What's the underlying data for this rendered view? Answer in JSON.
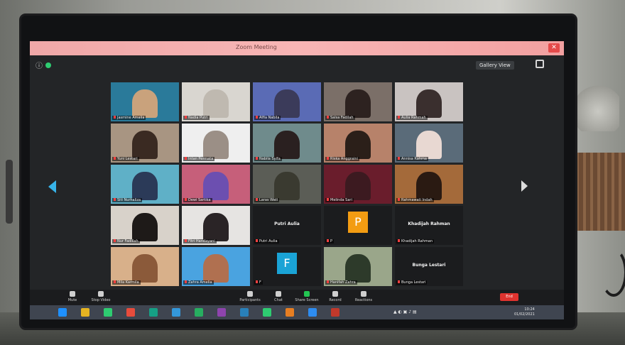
{
  "window": {
    "title": "Zoom Meeting",
    "view_label": "Gallery View",
    "end_label": "End"
  },
  "participants": [
    {
      "name": "Jasmine Amalia",
      "style": "photo",
      "bg": "#2a7a9a",
      "fg": "#c9a27c"
    },
    {
      "name": "Nadia Putri",
      "style": "photo",
      "bg": "#d9d6d0",
      "fg": "#bfb9b0"
    },
    {
      "name": "Alfia Nabila",
      "style": "photo",
      "bg": "#5a6bb5",
      "fg": "#3b3b5a"
    },
    {
      "name": "Salsa Fadilah",
      "style": "photo",
      "bg": "#7b6f68",
      "fg": "#2d2220"
    },
    {
      "name": "Aulia Rahmah",
      "style": "photo",
      "bg": "#c9c3c1",
      "fg": "#3a2f2e"
    },
    {
      "name": "Yuni Lestari",
      "style": "photo",
      "bg": "#a89582",
      "fg": "#3a2a22"
    },
    {
      "name": "Intan Permata",
      "style": "photo",
      "bg": "#efefef",
      "fg": "#9b8f86"
    },
    {
      "name": "Nabila Syifa",
      "style": "photo",
      "bg": "#6f8b8c",
      "fg": "#2a2020"
    },
    {
      "name": "Riska Anggraini",
      "style": "photo",
      "bg": "#b7826a",
      "fg": "#2b1f19"
    },
    {
      "name": "Annisa Rahma",
      "style": "photo",
      "bg": "#5a6b79",
      "fg": "#e8d8d2"
    },
    {
      "name": "Siti Nurhaliza",
      "style": "photo",
      "bg": "#5fb0c7",
      "fg": "#2b3a58"
    },
    {
      "name": "Dewi Sartika",
      "style": "photo",
      "bg": "#c65f7a",
      "fg": "#6c4fb0"
    },
    {
      "name": "Laras Wati",
      "style": "photo",
      "bg": "#5b5d56",
      "fg": "#3a3a30"
    },
    {
      "name": "Melinda Sari",
      "style": "photo",
      "bg": "#6a1d2c",
      "fg": "#3c1a20"
    },
    {
      "name": "Rahmawati Indah",
      "style": "photo",
      "bg": "#a46a3a",
      "fg": "#2a1a12"
    },
    {
      "name": "Nur Fadillah",
      "style": "photo",
      "bg": "#d8d2ca",
      "fg": "#1e1a18"
    },
    {
      "name": "Fitri Handayani",
      "style": "photo",
      "bg": "#e6e4e2",
      "fg": "#2a2426"
    },
    {
      "name": "Putri Aulia",
      "style": "text",
      "bg": "#1b1c1e",
      "label": "Putri Aulia"
    },
    {
      "name": "P",
      "style": "avatar",
      "bg": "#1b1c1e",
      "avatar": "P",
      "avatar_bg": "#f39c12"
    },
    {
      "name": "Khadijah Rahman",
      "style": "text",
      "bg": "#1b1c1e",
      "label": "Khadijah Rahman"
    },
    {
      "name": "Mila Karmila",
      "style": "photo",
      "bg": "#d8b08a",
      "fg": "#8b5a3a"
    },
    {
      "name": "Zahra Amelia",
      "style": "photo",
      "bg": "#4aa3e0",
      "fg": "#b07050"
    },
    {
      "name": "F",
      "style": "avatar",
      "bg": "#1b1c1e",
      "avatar": "F",
      "avatar_bg": "#1aa3d6"
    },
    {
      "name": "Hanifah Zahra",
      "style": "photo",
      "bg": "#9aa68a",
      "fg": "#2d3a2a"
    },
    {
      "name": "Bunga Lestari",
      "style": "text",
      "bg": "#1b1c1e",
      "label": "Bunga Lestari"
    }
  ],
  "controls": [
    {
      "label": "Mute",
      "icon": "microphone-icon"
    },
    {
      "label": "Stop Video",
      "icon": "video-camera-icon"
    },
    {
      "label": "Participants",
      "icon": "participants-icon"
    },
    {
      "label": "Chat",
      "icon": "chat-icon"
    },
    {
      "label": "Share Screen",
      "icon": "share-screen-icon",
      "accent": true
    },
    {
      "label": "Record",
      "icon": "record-icon"
    },
    {
      "label": "Reactions",
      "icon": "reactions-icon"
    }
  ],
  "taskbar": {
    "clock_time": "10:24",
    "clock_date": "01/02/2021"
  }
}
